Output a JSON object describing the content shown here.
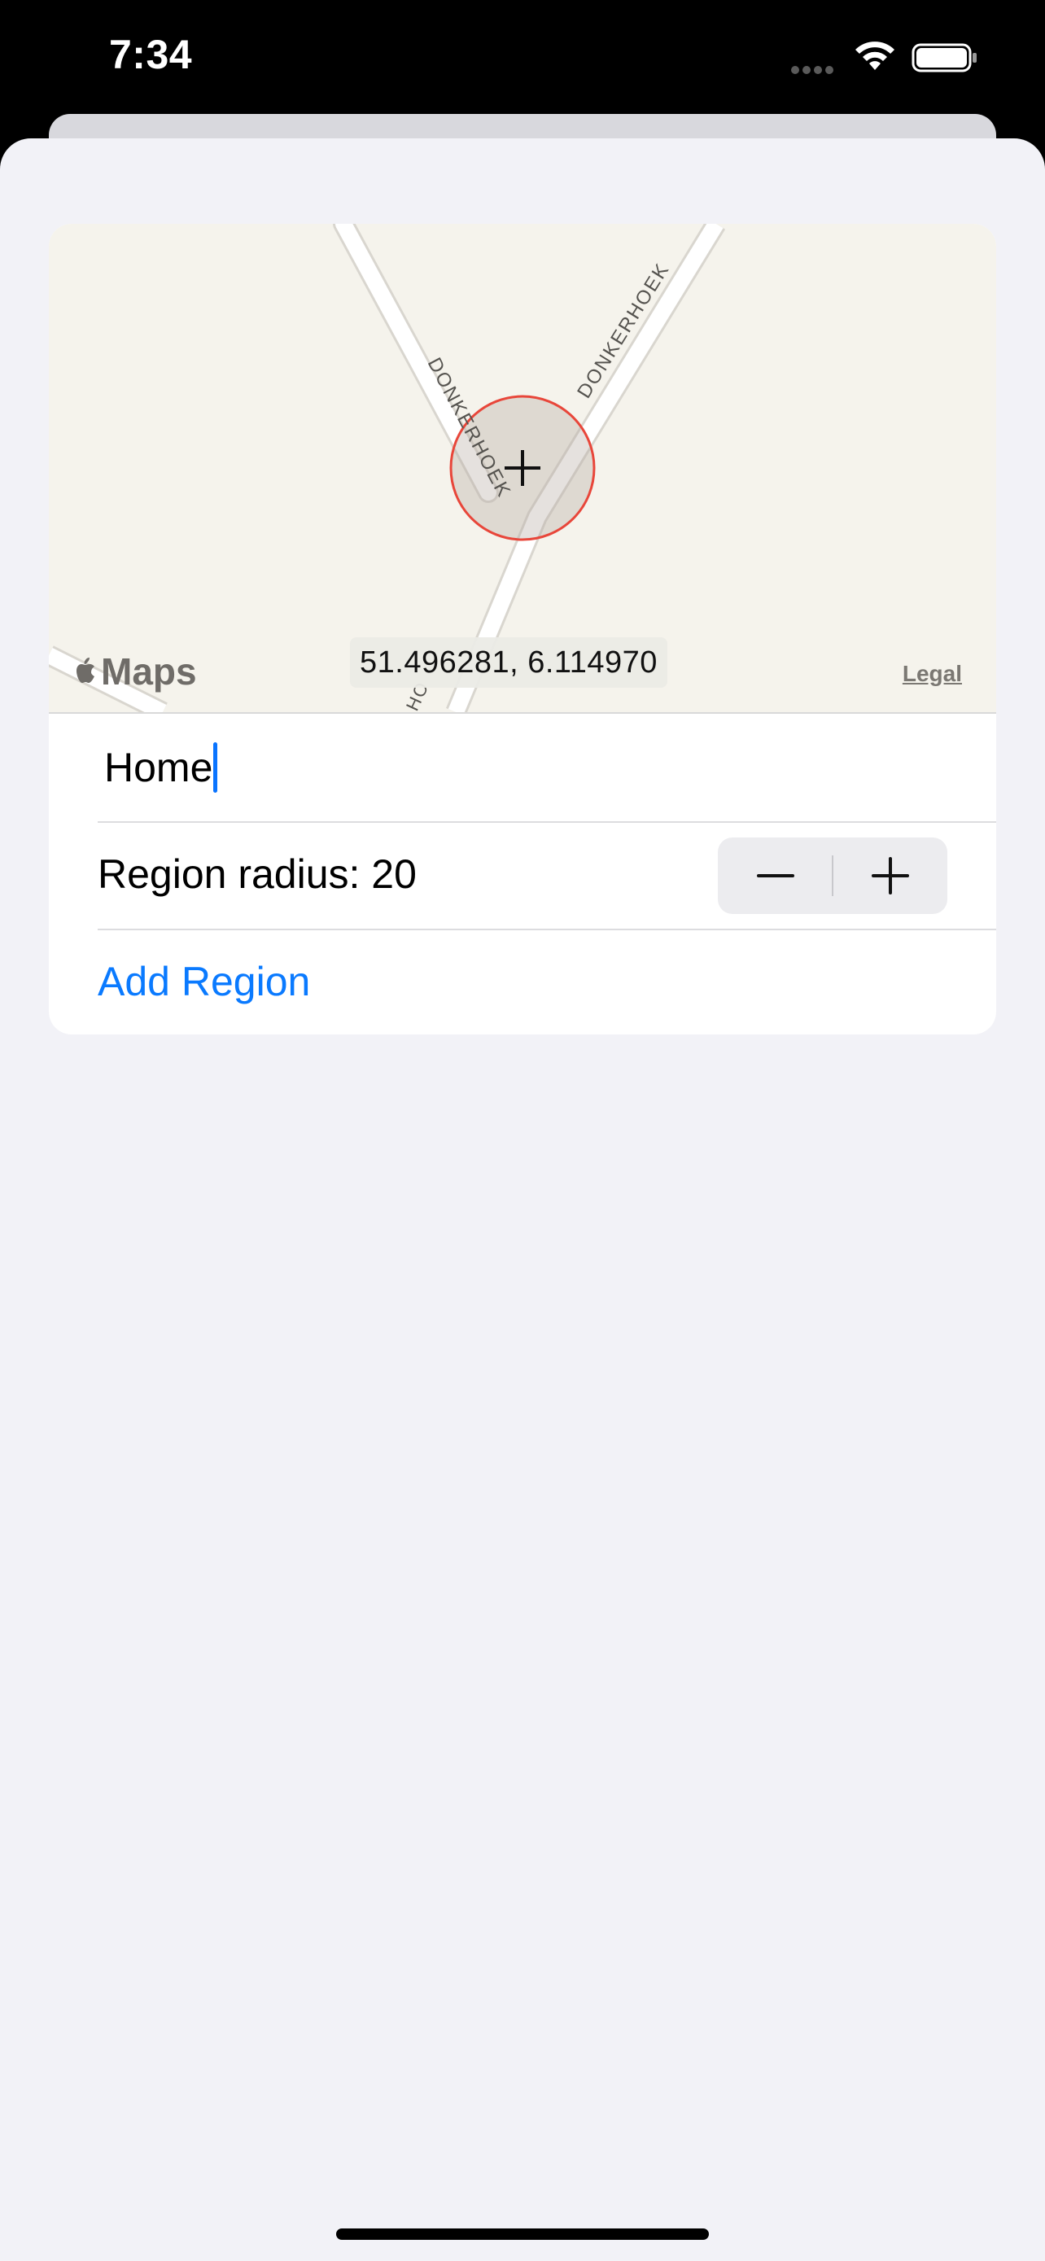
{
  "status_bar": {
    "time": "7:34",
    "signal_icon": "cellular-dots-icon",
    "wifi_icon": "wifi-icon",
    "battery_icon": "battery-icon"
  },
  "map": {
    "road_labels": [
      "DONKERHOEK",
      "DONKERHOEK",
      "HO"
    ],
    "coordinates": "51.496281, 6.114970",
    "logo_text": "Maps",
    "legal_link": "Legal",
    "center_icon": "crosshair-icon",
    "region_circle_color": "#e8463a"
  },
  "form": {
    "name_value": "Home",
    "radius_label": "Region radius: 20",
    "stepper": {
      "decrement_icon": "minus-icon",
      "increment_icon": "plus-icon"
    },
    "add_button_label": "Add Region"
  },
  "colors": {
    "accent": "#0a7aff",
    "background": "#f2f2f7",
    "card": "#ffffff",
    "map": "#f5f3ec"
  }
}
